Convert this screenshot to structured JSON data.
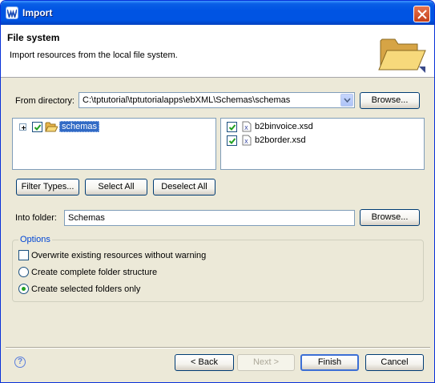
{
  "window": {
    "title": "Import",
    "title_icon": "wtp-logo-icon",
    "close_icon": "close-icon"
  },
  "banner": {
    "title": "File system",
    "description": "Import resources from the local file system.",
    "icon": "open-folder-icon"
  },
  "from_directory": {
    "label": "From directory:",
    "value": "C:\\tptutorial\\tptutorialapps\\ebXML\\Schemas\\schemas",
    "browse_label": "Browse..."
  },
  "tree": {
    "items": [
      {
        "label": "schemas",
        "checked": true,
        "expanded": false,
        "selected": true
      }
    ]
  },
  "files": {
    "items": [
      {
        "label": "b2binvoice.xsd",
        "checked": true
      },
      {
        "label": "b2border.xsd",
        "checked": true
      }
    ]
  },
  "selection_buttons": {
    "filter_types": "Filter Types...",
    "select_all": "Select All",
    "deselect_all": "Deselect All"
  },
  "into_folder": {
    "label": "Into folder:",
    "value": "Schemas",
    "browse_label": "Browse..."
  },
  "options": {
    "title": "Options",
    "overwrite": {
      "label": "Overwrite existing resources without warning",
      "checked": false
    },
    "radios": [
      {
        "label": "Create complete folder structure",
        "selected": false
      },
      {
        "label": "Create selected folders only",
        "selected": true
      }
    ]
  },
  "footer": {
    "back": "< Back",
    "next": "Next >",
    "finish": "Finish",
    "cancel": "Cancel",
    "help": "?"
  },
  "colors": {
    "titlebar": "#0054e3",
    "dialog_bg": "#ece9d8",
    "selection": "#316ac5",
    "group_title": "#0046d5"
  }
}
